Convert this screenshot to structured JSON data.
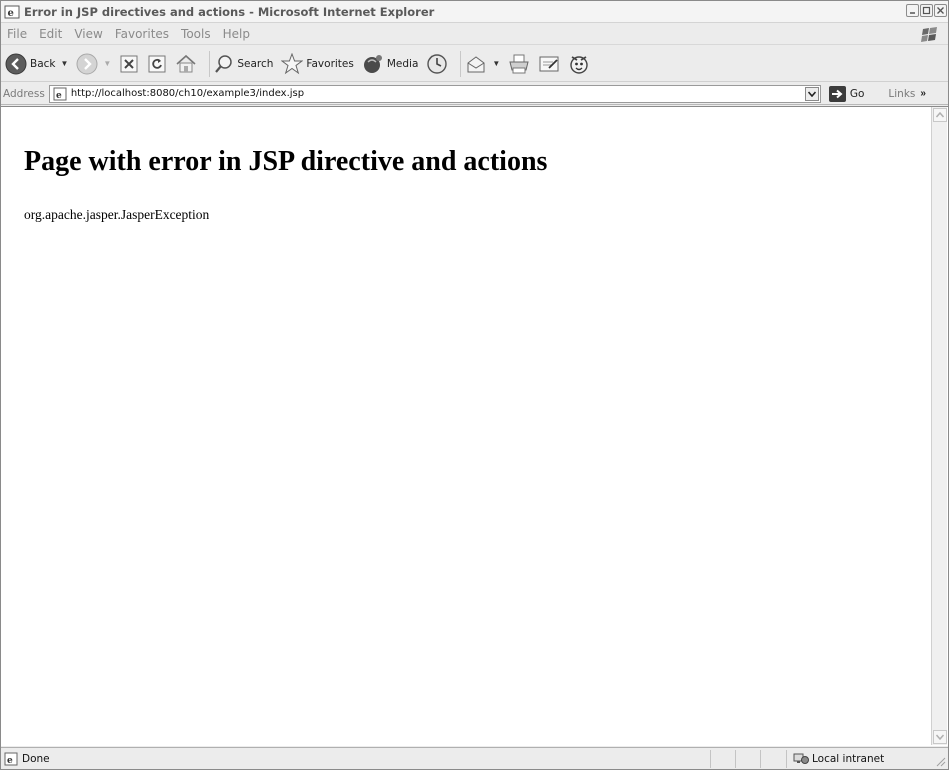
{
  "window": {
    "title": "Error in JSP directives and actions - Microsoft Internet Explorer"
  },
  "menu": {
    "items": [
      "File",
      "Edit",
      "View",
      "Favorites",
      "Tools",
      "Help"
    ]
  },
  "toolbar": {
    "back_label": "Back",
    "search_label": "Search",
    "favorites_label": "Favorites",
    "media_label": "Media"
  },
  "address": {
    "label": "Address",
    "url": "http://localhost:8080/ch10/example3/index.jsp",
    "go_label": "Go",
    "links_label": "Links",
    "links_chevron": "»"
  },
  "page": {
    "heading": "Page with error in JSP directive and actions",
    "body_text": "org.apache.jasper.JasperException"
  },
  "status": {
    "text": "Done",
    "zone": "Local intranet"
  },
  "colors": {
    "chrome_bg": "#ececec",
    "content_bg": "#ffffff",
    "disabled_text": "#8a8a8a"
  }
}
